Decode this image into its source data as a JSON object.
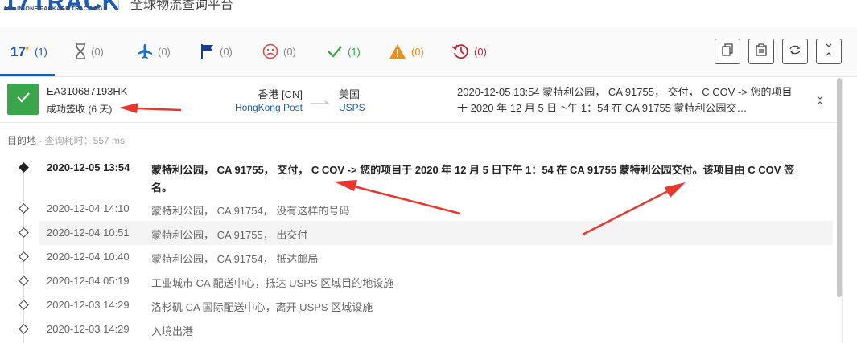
{
  "header": {
    "logo_text": "17TRACK",
    "logo_sub": "ALL-IN-ONE PACKAGE TRACKING",
    "title": "全球物流查询平台"
  },
  "filter_tabs": [
    {
      "icon": "17track-logo-icon",
      "count": "(1)"
    },
    {
      "icon": "hourglass-icon",
      "count": "(0)"
    },
    {
      "icon": "airplane-icon",
      "count": "(0)"
    },
    {
      "icon": "flag-icon",
      "count": "(0)"
    },
    {
      "icon": "sad-face-icon",
      "count": "(0)"
    },
    {
      "icon": "checkmark-icon",
      "count": "(1)"
    },
    {
      "icon": "warning-icon",
      "count": "(0)"
    },
    {
      "icon": "history-icon",
      "count": "(0)"
    }
  ],
  "toolbar_buttons": [
    "copy-icon",
    "paste-icon",
    "refresh-icon",
    "collapse-icon"
  ],
  "shipment": {
    "tracking_number": "EA310687193HK",
    "status": "成功签收 (6 天)",
    "origin_country": "香港 [CN]",
    "origin_carrier": "HongKong Post",
    "dest_country": "美国",
    "dest_carrier": "USPS",
    "latest_event": "2020-12-05 13:54  蒙特利公园， CA 91755， 交付， C COV -> 您的项目于 2020 年 12 月 5 日下午 1：54 在 CA 91755 蒙特利公园交…"
  },
  "section": {
    "label": "目的地",
    "query_time": " - 查询耗时：557 ms"
  },
  "events": [
    {
      "time": "2020-12-05 13:54",
      "desc": "蒙特利公园， CA 91755， 交付， C COV -> 您的项目于 2020 年 12 月 5 日下午 1：54 在 CA 91755 蒙特利公园交付。该项目由 C COV 签",
      "desc2": "名。"
    },
    {
      "time": "2020-12-04 14:10",
      "desc": "蒙特利公园， CA 91754， 没有这样的号码"
    },
    {
      "time": "2020-12-04 10:51",
      "desc": "蒙特利公园， CA 91755， 出交付"
    },
    {
      "time": "2020-12-04 10:40",
      "desc": "蒙特利公园， CA 91754， 抵达邮局"
    },
    {
      "time": "2020-12-04 05:19",
      "desc": "工业城市 CA 配送中心，抵达 USPS 区域目的地设施"
    },
    {
      "time": "2020-12-03 14:29",
      "desc": "洛杉矶 CA 国际配送中心，离开 USPS 区域设施"
    },
    {
      "time": "2020-12-03 14:29",
      "desc": "入境出港"
    }
  ],
  "colors": {
    "brand_blue": "#1a5bb8",
    "success_green": "#3aa54a",
    "annotation_red": "#e8382e",
    "warning_orange": "#f08c1a"
  }
}
